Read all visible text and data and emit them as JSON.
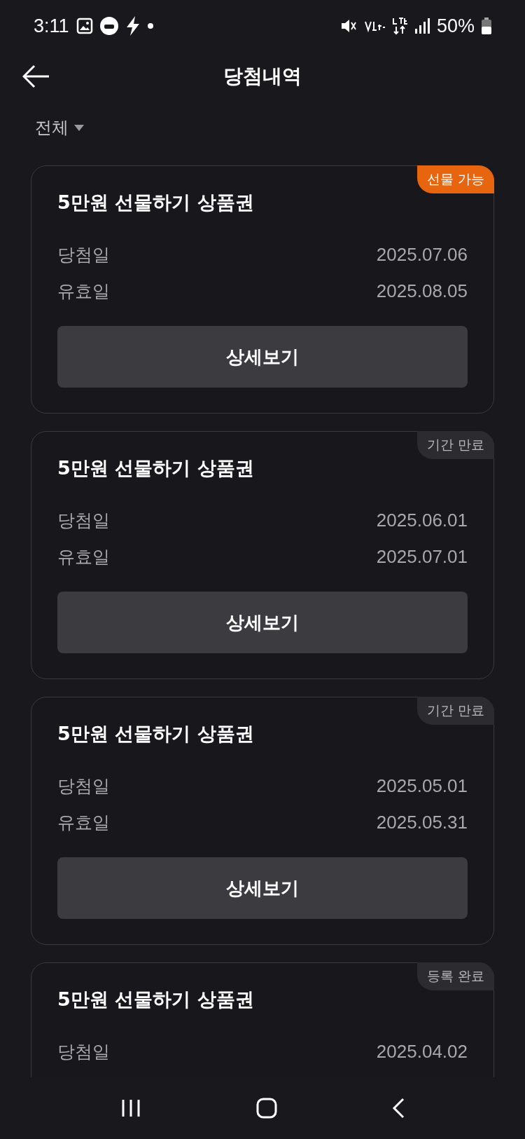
{
  "status_bar": {
    "time": "3:11",
    "battery": "50%"
  },
  "header": {
    "title": "당첨내역"
  },
  "filter": {
    "label": "전체"
  },
  "cards": [
    {
      "title": "5만원 선물하기 상품권",
      "badge": {
        "label": "선물 가능",
        "kind": "active"
      },
      "rows": [
        {
          "label": "당첨일",
          "value": "2025.07.06"
        },
        {
          "label": "유효일",
          "value": "2025.08.05"
        }
      ],
      "button": "상세보기"
    },
    {
      "title": "5만원 선물하기 상품권",
      "badge": {
        "label": "기간 만료",
        "kind": "inactive"
      },
      "rows": [
        {
          "label": "당첨일",
          "value": "2025.06.01"
        },
        {
          "label": "유효일",
          "value": "2025.07.01"
        }
      ],
      "button": "상세보기"
    },
    {
      "title": "5만원 선물하기 상품권",
      "badge": {
        "label": "기간 만료",
        "kind": "inactive"
      },
      "rows": [
        {
          "label": "당첨일",
          "value": "2025.05.01"
        },
        {
          "label": "유효일",
          "value": "2025.05.31"
        }
      ],
      "button": "상세보기"
    },
    {
      "title": "5만원 선물하기 상품권",
      "badge": {
        "label": "등록 완료",
        "kind": "inactive"
      },
      "rows": [
        {
          "label": "당첨일",
          "value": "2025.04.02"
        }
      ]
    }
  ]
}
